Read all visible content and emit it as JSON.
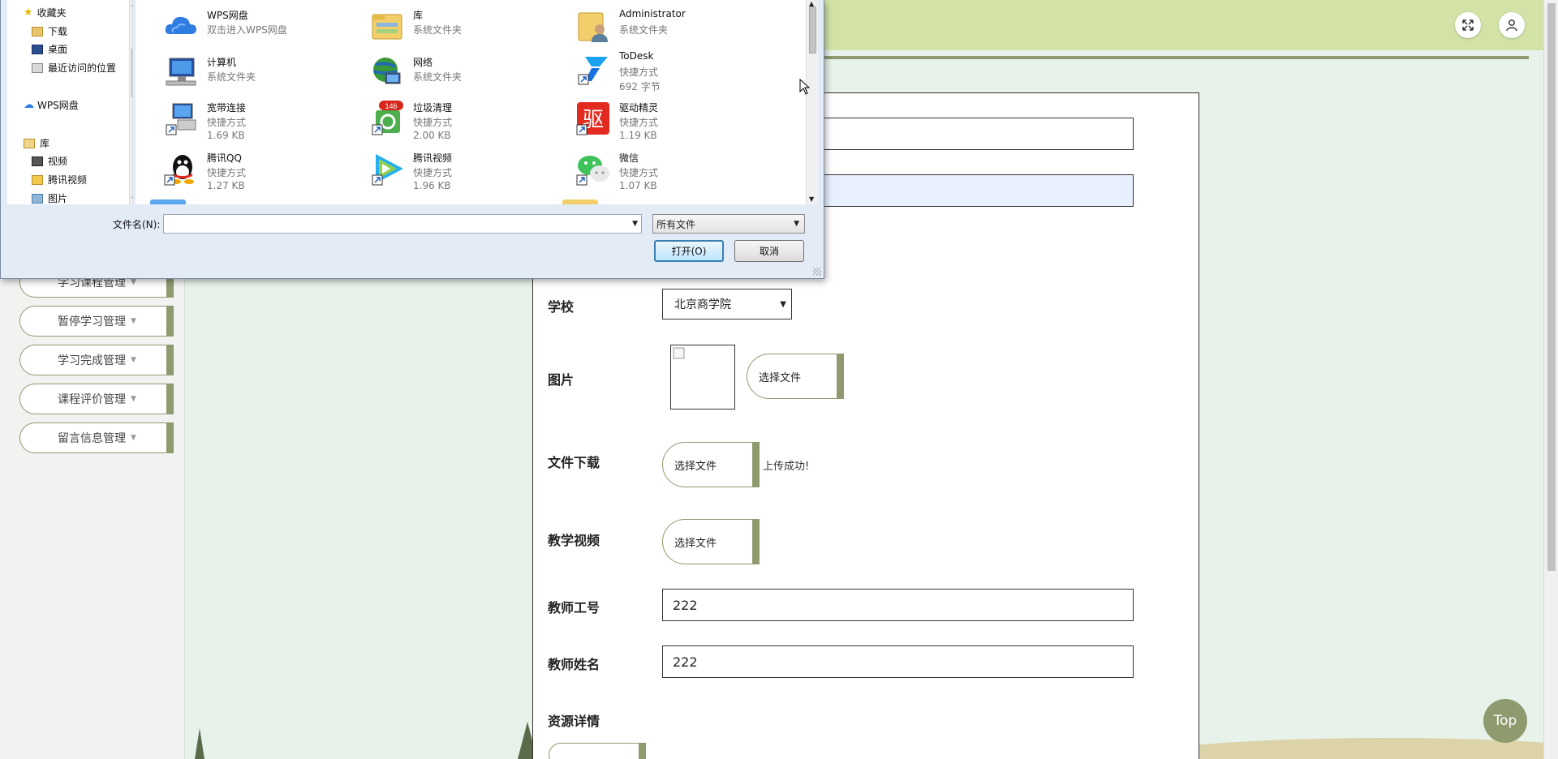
{
  "dialog": {
    "nav": {
      "favorites": "收藏夹",
      "downloads": "下载",
      "desktop": "桌面",
      "recent": "最近访问的位置",
      "wps_drive": "WPS网盘",
      "library": "库",
      "videos": "视频",
      "tencent_video": "腾讯视频",
      "pictures": "图片"
    },
    "files": [
      {
        "name": "WPS网盘",
        "line1": "双击进入WPS网盘",
        "line2": "",
        "icon": "cloud-icon"
      },
      {
        "name": "库",
        "line1": "系统文件夹",
        "line2": "",
        "icon": "library-folder-icon"
      },
      {
        "name": "Administrator",
        "line1": "系统文件夹",
        "line2": "",
        "icon": "user-folder-icon"
      },
      {
        "name": "计算机",
        "line1": "系统文件夹",
        "line2": "",
        "icon": "computer-icon"
      },
      {
        "name": "网络",
        "line1": "系统文件夹",
        "line2": "",
        "icon": "network-icon"
      },
      {
        "name": "ToDesk",
        "line1": "快捷方式",
        "line2": "692 字节",
        "icon": "todesk-icon"
      },
      {
        "name": "宽带连接",
        "line1": "快捷方式",
        "line2": "1.69 KB",
        "icon": "broadband-icon"
      },
      {
        "name": "垃圾清理",
        "line1": "快捷方式",
        "line2": "2.00 KB",
        "icon": "recycle-icon",
        "badge": "146"
      },
      {
        "name": "驱动精灵",
        "line1": "快捷方式",
        "line2": "1.19 KB",
        "icon": "driver-icon",
        "glyph": "驱"
      },
      {
        "name": "腾讯QQ",
        "line1": "快捷方式",
        "line2": "1.27 KB",
        "icon": "qq-icon"
      },
      {
        "name": "腾讯视频",
        "line1": "快捷方式",
        "line2": "1.96 KB",
        "icon": "tencent-video-icon"
      },
      {
        "name": "微信",
        "line1": "快捷方式",
        "line2": "1.07 KB",
        "icon": "wechat-icon"
      }
    ],
    "filename_label": "文件名(N):",
    "filename_value": "",
    "filetype": "所有文件",
    "open_label": "打开(O)",
    "cancel_label": "取消"
  },
  "sidebar": {
    "items": [
      {
        "label": "学习课程管理"
      },
      {
        "label": "暂停学习管理"
      },
      {
        "label": "学习完成管理"
      },
      {
        "label": "课程评价管理"
      },
      {
        "label": "留言信息管理"
      }
    ]
  },
  "form": {
    "school_label": "学校",
    "school_value": "北京商学院",
    "image_label": "图片",
    "choose_file": "选择文件",
    "download_label": "文件下载",
    "upload_success": "上传成功!",
    "video_label": "教学视频",
    "teacher_id_label": "教师工号",
    "teacher_id_value": "222",
    "teacher_name_label": "教师姓名",
    "teacher_name_value": "222",
    "detail_label": "资源详情"
  },
  "top_button": "Top",
  "colors": {
    "accent": "#8f9a6e",
    "header": "#d3e3a8",
    "page_bg": "#e6f2ea",
    "dialog_bg": "#e2ebf6"
  }
}
